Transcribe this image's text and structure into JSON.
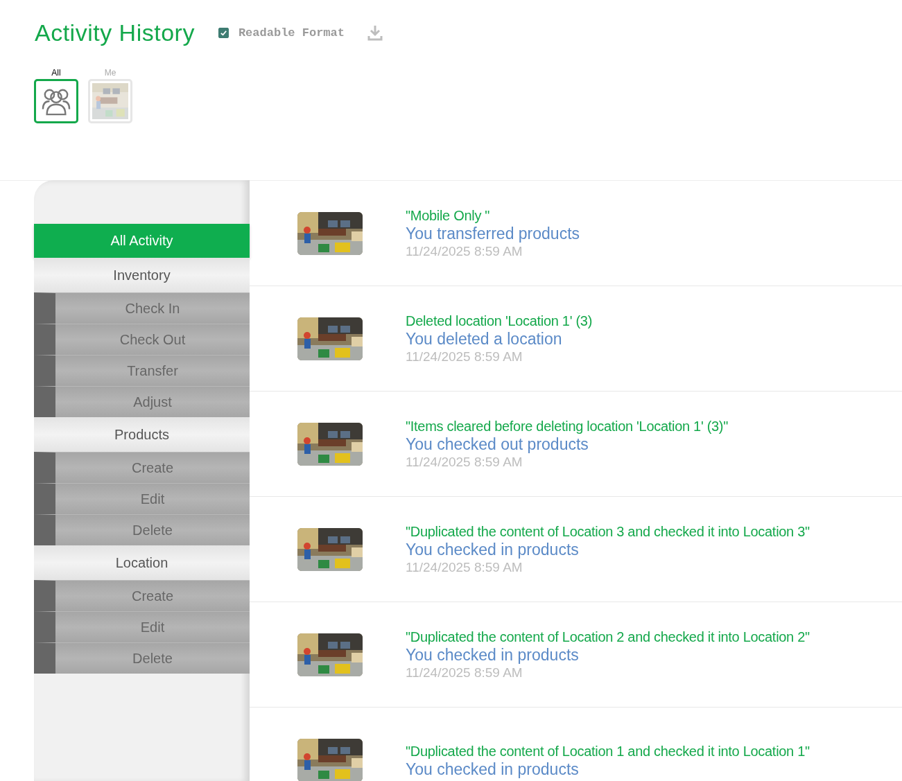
{
  "title": "Activity History",
  "readable_format": {
    "label": "Readable Format",
    "checked": true
  },
  "user_filters": [
    {
      "label": "All",
      "selected": true,
      "kind": "group"
    },
    {
      "label": "Me",
      "selected": false,
      "kind": "picture"
    }
  ],
  "sidebar": {
    "items": [
      {
        "label": "All Activity",
        "kind": "all",
        "selected": true
      },
      {
        "label": "Inventory",
        "kind": "category",
        "selected": false
      },
      {
        "label": "Check In",
        "kind": "sub",
        "selected": false
      },
      {
        "label": "Check Out",
        "kind": "sub",
        "selected": false
      },
      {
        "label": "Transfer",
        "kind": "sub",
        "selected": false
      },
      {
        "label": "Adjust",
        "kind": "sub",
        "selected": false
      },
      {
        "label": "Products",
        "kind": "category",
        "selected": false
      },
      {
        "label": "Create",
        "kind": "sub",
        "selected": false
      },
      {
        "label": "Edit",
        "kind": "sub",
        "selected": false
      },
      {
        "label": "Delete",
        "kind": "sub",
        "selected": false
      },
      {
        "label": "Location",
        "kind": "category",
        "selected": false
      },
      {
        "label": "Create",
        "kind": "sub",
        "selected": false
      },
      {
        "label": "Edit",
        "kind": "sub",
        "selected": false
      },
      {
        "label": "Delete",
        "kind": "sub",
        "selected": false
      }
    ]
  },
  "activities": [
    {
      "note": "\"Mobile Only \"",
      "action": "You transferred products",
      "time": "11/24/2025 8:59 AM"
    },
    {
      "note": "Deleted location 'Location 1' (3)",
      "action": "You deleted a location",
      "time": "11/24/2025 8:59 AM"
    },
    {
      "note": "\"Items cleared before deleting location 'Location 1' (3)\"",
      "action": "You checked out products",
      "time": "11/24/2025 8:59 AM"
    },
    {
      "note": "\"Duplicated the content of Location 3 and checked it into Location 3\"",
      "action": "You checked in products",
      "time": "11/24/2025 8:59 AM"
    },
    {
      "note": "\"Duplicated the content of Location 2 and checked it into Location 2\"",
      "action": "You checked in products",
      "time": "11/24/2025 8:59 AM"
    },
    {
      "note": "\"Duplicated the content of Location 1 and checked it into Location 1\"",
      "action": "You checked in products"
    }
  ]
}
